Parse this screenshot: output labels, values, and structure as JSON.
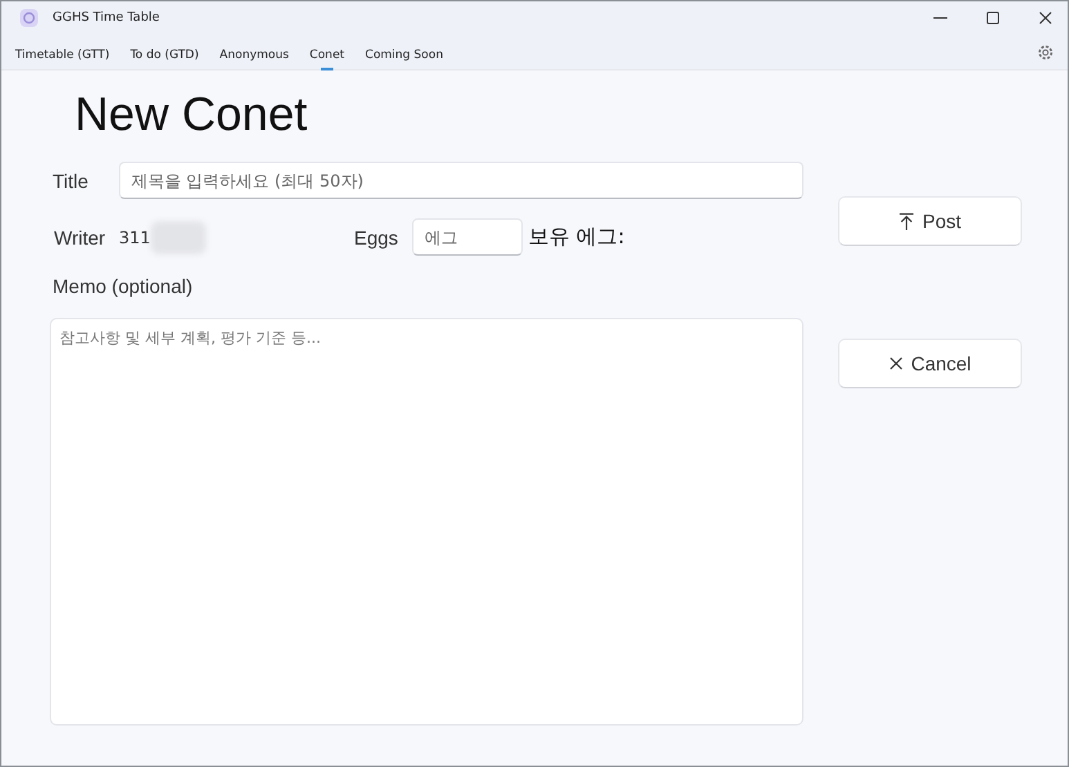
{
  "window": {
    "title": "GGHS Time Table"
  },
  "tabs": [
    {
      "label": "Timetable (GTT)",
      "selected": false
    },
    {
      "label": "To do (GTD)",
      "selected": false
    },
    {
      "label": "Anonymous",
      "selected": false
    },
    {
      "label": "Conet",
      "selected": true
    },
    {
      "label": "Coming Soon",
      "selected": false
    }
  ],
  "heading": "New Conet",
  "title_field": {
    "label": "Title",
    "placeholder": "제목을 입력하세요 (최대 50자)"
  },
  "writer": {
    "label": "Writer",
    "value": "311"
  },
  "eggs": {
    "label": "Eggs",
    "placeholder": "에그",
    "owned_label": "보유 에그:"
  },
  "memo": {
    "label": "Memo (optional)",
    "placeholder": "참고사항 및 세부 계획, 평가 기준 등..."
  },
  "buttons": [
    {
      "kind": "post",
      "label": "Post"
    },
    {
      "kind": "cancel",
      "label": "Cancel"
    }
  ]
}
